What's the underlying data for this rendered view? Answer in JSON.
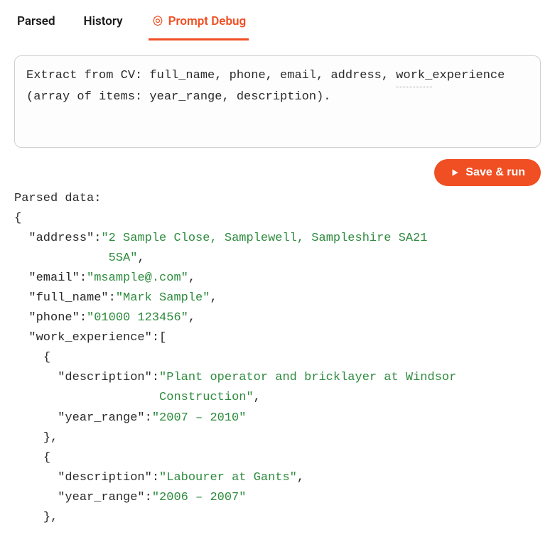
{
  "tabs": {
    "parsed": "Parsed",
    "history": "History",
    "prompt_debug": "Prompt Debug"
  },
  "prompt": {
    "line1": "Extract from CV: full_name, phone, email, address,",
    "line2_prefix": "work_",
    "line2_rest": "experience (array of items: year_range, description)."
  },
  "buttons": {
    "save_run": "Save & run"
  },
  "output": {
    "heading": "Parsed data:",
    "open_brace": "{",
    "address_key": "\"address\"",
    "address_val_line1": "\"2 Sample Close, Samplewell, Sampleshire SA21",
    "address_val_line2": "5SA\"",
    "email_key": "\"email\"",
    "email_val": "\"msample@.com\"",
    "full_name_key": "\"full_name\"",
    "full_name_val": "\"Mark Sample\"",
    "phone_key": "\"phone\"",
    "phone_val": "\"01000 123456\"",
    "work_exp_key": "\"work_experience\"",
    "open_bracket": "[",
    "item_open": "{",
    "desc_key": "\"description\"",
    "desc1_line1": "\"Plant operator and bricklayer at Windsor",
    "desc1_line2": "Construction\"",
    "year_key": "\"year_range\"",
    "year1_val": "\"2007 – 2010\"",
    "item_close": "},",
    "desc2_val": "\"Labourer at Gants\"",
    "year2_val": "\"2006 – 2007\""
  }
}
